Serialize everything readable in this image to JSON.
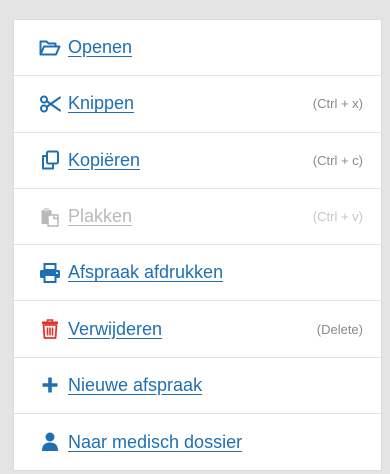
{
  "colors": {
    "link": "#1f6fb2",
    "danger": "#e0332a",
    "disabled": "#b9b9b9",
    "shortcut": "#8a8a8a"
  },
  "menu": {
    "items": [
      {
        "label": "Openen",
        "shortcut": "",
        "icon": "folder-open-icon",
        "enabled": true
      },
      {
        "label": "Knippen",
        "shortcut": "(Ctrl + x)",
        "icon": "scissors-icon",
        "enabled": true
      },
      {
        "label": "Kopiëren",
        "shortcut": "(Ctrl + c)",
        "icon": "copy-icon",
        "enabled": true
      },
      {
        "label": "Plakken",
        "shortcut": "(Ctrl + v)",
        "icon": "paste-icon",
        "enabled": false
      },
      {
        "label": "Afspraak afdrukken",
        "shortcut": "",
        "icon": "printer-icon",
        "enabled": true
      },
      {
        "label": "Verwijderen",
        "shortcut": "(Delete)",
        "icon": "trash-icon",
        "enabled": true
      },
      {
        "label": "Nieuwe afspraak",
        "shortcut": "",
        "icon": "plus-icon",
        "enabled": true
      },
      {
        "label": "Naar medisch dossier",
        "shortcut": "",
        "icon": "user-icon",
        "enabled": true
      }
    ]
  }
}
